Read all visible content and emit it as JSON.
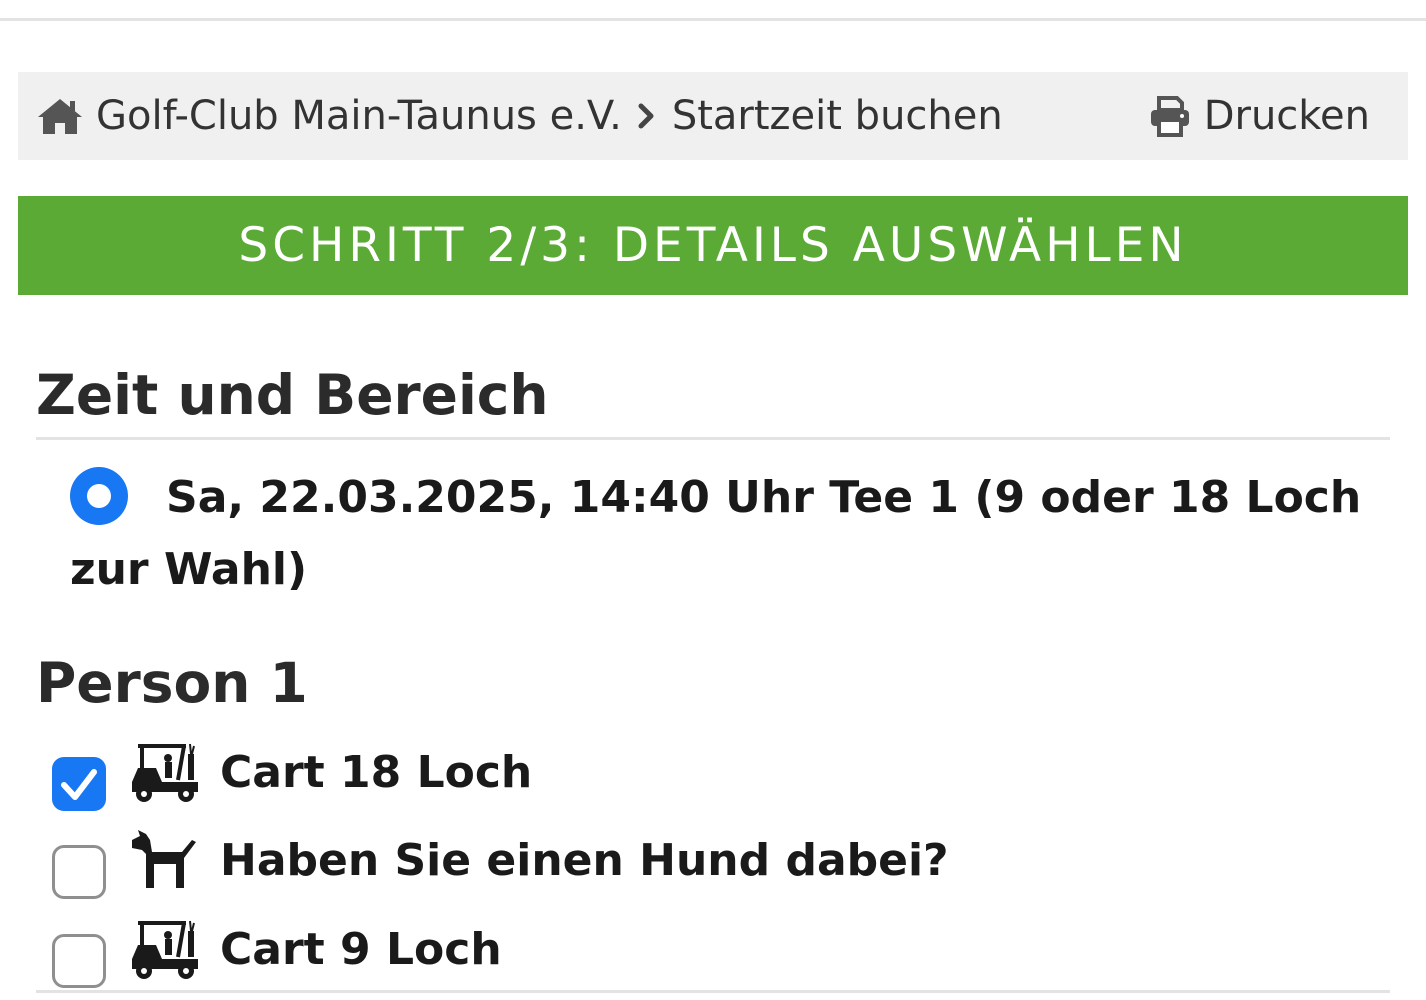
{
  "breadcrumb": {
    "home_icon": "home-icon",
    "club": "Golf-Club Main-Taunus e.V.",
    "separator_icon": "chevron-right-icon",
    "current": "Startzeit buchen"
  },
  "print": {
    "icon": "printer-icon",
    "label": "Drucken"
  },
  "step_banner": {
    "title": "SCHRITT 2/3: DETAILS AUSWÄHLEN",
    "color": "#5aaa35"
  },
  "time_section": {
    "heading": "Zeit und Bereich",
    "slot": {
      "selected": true,
      "label": "Sa, 22.03.2025, 14:40 Uhr Tee 1 (9 oder 18 Loch zur Wahl)"
    }
  },
  "person_section": {
    "heading": "Person 1",
    "options": [
      {
        "icon": "golf-cart-icon",
        "label": "Cart 18 Loch",
        "checked": true
      },
      {
        "icon": "dog-icon",
        "label": "Haben Sie einen Hund dabei?",
        "checked": false
      },
      {
        "icon": "golf-cart-icon",
        "label": "Cart 9 Loch",
        "checked": false
      }
    ]
  },
  "accent_color": "#1877f2"
}
